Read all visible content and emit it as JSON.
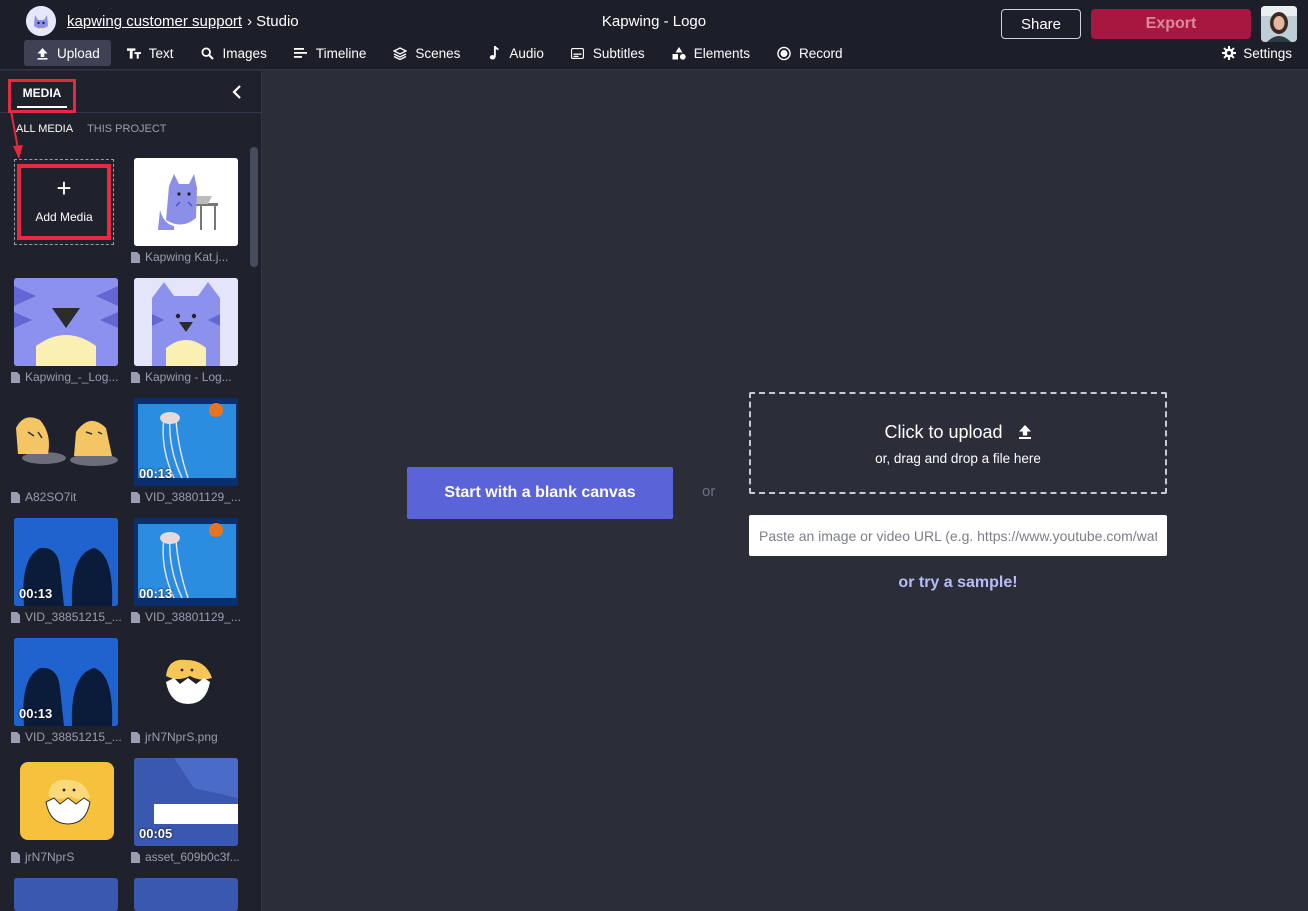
{
  "header": {
    "team_name": "kapwing customer support",
    "separator": "›",
    "section": "Studio",
    "project_title": "Kapwing - Logo",
    "share_label": "Share",
    "export_label": "Export"
  },
  "toolbar": {
    "items": [
      {
        "label": "Upload",
        "icon": "upload-icon"
      },
      {
        "label": "Text",
        "icon": "text-icon"
      },
      {
        "label": "Images",
        "icon": "search-icon"
      },
      {
        "label": "Timeline",
        "icon": "timeline-icon"
      },
      {
        "label": "Scenes",
        "icon": "layers-icon"
      },
      {
        "label": "Audio",
        "icon": "music-note-icon"
      },
      {
        "label": "Subtitles",
        "icon": "subtitles-icon"
      },
      {
        "label": "Elements",
        "icon": "shapes-icon"
      },
      {
        "label": "Record",
        "icon": "record-icon"
      }
    ],
    "settings_label": "Settings"
  },
  "sidebar": {
    "tab_label": "MEDIA",
    "subtabs": [
      "ALL MEDIA",
      "THIS PROJECT"
    ],
    "add_media_label": "Add Media",
    "add_media_plus": "+",
    "items": [
      {
        "name": "Kapwing Kat.j...",
        "duration": ""
      },
      {
        "name": "Kapwing_-_Log...",
        "duration": ""
      },
      {
        "name": "Kapwing - Log...",
        "duration": ""
      },
      {
        "name": "A82SO7it",
        "duration": ""
      },
      {
        "name": "VID_38801129_...",
        "duration": "00:13"
      },
      {
        "name": "VID_38851215_...",
        "duration": "00:13"
      },
      {
        "name": "VID_38801129_...",
        "duration": "00:13"
      },
      {
        "name": "VID_38851215_...",
        "duration": "00:13"
      },
      {
        "name": "jrN7NprS.png",
        "duration": ""
      },
      {
        "name": "jrN7NprS",
        "duration": ""
      },
      {
        "name": "asset_609b0c3f...",
        "duration": "00:05"
      }
    ]
  },
  "main": {
    "start_button": "Start with a blank canvas",
    "or_text": "or",
    "upload_title": "Click to upload",
    "upload_sub": "or, drag and drop a file here",
    "url_placeholder": "Paste an image or video URL (e.g. https://www.youtube.com/watch?v=...)",
    "sample_link": "or try a sample!"
  },
  "colors": {
    "accent": "#5b63d8",
    "export": "#a8173f",
    "highlight": "#e6293f"
  }
}
